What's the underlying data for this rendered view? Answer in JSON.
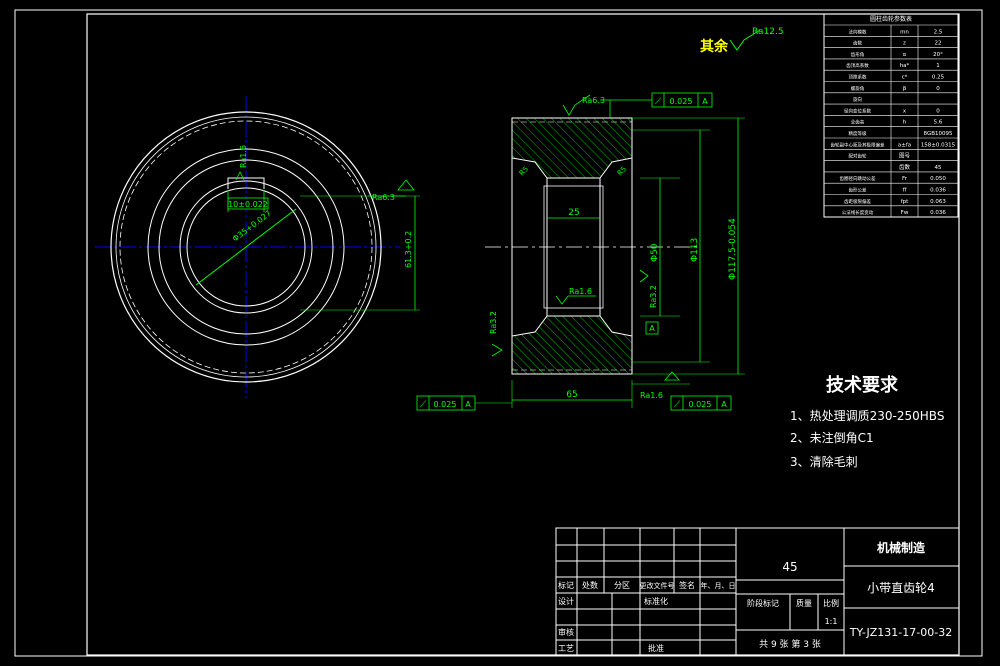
{
  "surface_note": {
    "prefix": "其余",
    "value": "Ra12.5"
  },
  "param_table": {
    "title": "圆柱齿轮参数表",
    "rows": [
      {
        "label": "法向模数",
        "sym": "mn",
        "val": "2.5"
      },
      {
        "label": "齿数",
        "sym": "z",
        "val": "22"
      },
      {
        "label": "齿形角",
        "sym": "α",
        "val": "20°"
      },
      {
        "label": "齿顶高系数",
        "sym": "ha*",
        "val": "1"
      },
      {
        "label": "顶隙系数",
        "sym": "c*",
        "val": "0.25"
      },
      {
        "label": "螺旋角",
        "sym": "β",
        "val": "0"
      },
      {
        "label": "旋向",
        "sym": "",
        "val": ""
      },
      {
        "label": "径向变位系数",
        "sym": "x",
        "val": "0"
      },
      {
        "label": "全齿高",
        "sym": "h",
        "val": "5.6"
      },
      {
        "label": "精度等级",
        "sym": "",
        "val": "8GB10095"
      },
      {
        "label": "齿轮副中心距及其极限偏差",
        "sym": "a±fa",
        "val": "158±0.0315"
      },
      {
        "label": "配对齿轮",
        "sym": "图号",
        "val": ""
      },
      {
        "label": "",
        "sym": "齿数",
        "val": "45"
      },
      {
        "label": "齿圈径向跳动公差",
        "sym": "Fr",
        "val": "0.050"
      },
      {
        "label": "齿形公差",
        "sym": "ff",
        "val": "0.036"
      },
      {
        "label": "齿距极限偏差",
        "sym": "fpt",
        "val": "0.063"
      },
      {
        "label": "公法线长度变动",
        "sym": "Fw",
        "val": "0.036"
      }
    ]
  },
  "tech_req": {
    "title": "技术要求",
    "items": [
      "1、热处理调质230-250HBS",
      "2、未注倒角C1",
      "3、清除毛刺"
    ]
  },
  "front_view": {
    "roughness_bore": "Ra1.6",
    "roughness_hub": "Ra6.3",
    "keyway_dim": "10±0.022",
    "bore_dia": "Φ35+0.027",
    "keyway_depth": "61.3+0.2"
  },
  "section_view": {
    "top_roughness": "Ra6.3",
    "runout_top": [
      "⟋",
      "0.025",
      "A"
    ],
    "runout_bl": [
      "⟋",
      "0.025",
      "A"
    ],
    "runout_br": [
      "⟋",
      "0.025",
      "A"
    ],
    "bore_width": "25",
    "hub_dia": "Φ50",
    "root_dia": "Φ113",
    "tip_dia": "Φ117.5-0.054",
    "face_width": "65",
    "ra_inner": "Ra1.6",
    "ra_right": "Ra3.2",
    "ra_left": "Ra3.2",
    "ra_bottom": "Ra1.6",
    "chamfer_l": "R5",
    "chamfer_r": "R5",
    "datum": "A"
  },
  "title_block": {
    "material": "45",
    "company": "机械制造",
    "part_name": "小带直齿轮4",
    "drawing_no": "TY-JZ131-17-00-32",
    "scale": "1:1",
    "sheets": "共 9 张    第 3 张",
    "labels": {
      "mark": "标记",
      "count": "处数",
      "zone": "分区",
      "change_doc": "更改文件号",
      "sign": "签名",
      "date": "年、月、日",
      "design": "设计",
      "standard": "标准化",
      "stage": "阶段标记",
      "weight": "质量",
      "ratio": "比例",
      "check": "审核",
      "process": "工艺",
      "approve": "批准"
    }
  }
}
